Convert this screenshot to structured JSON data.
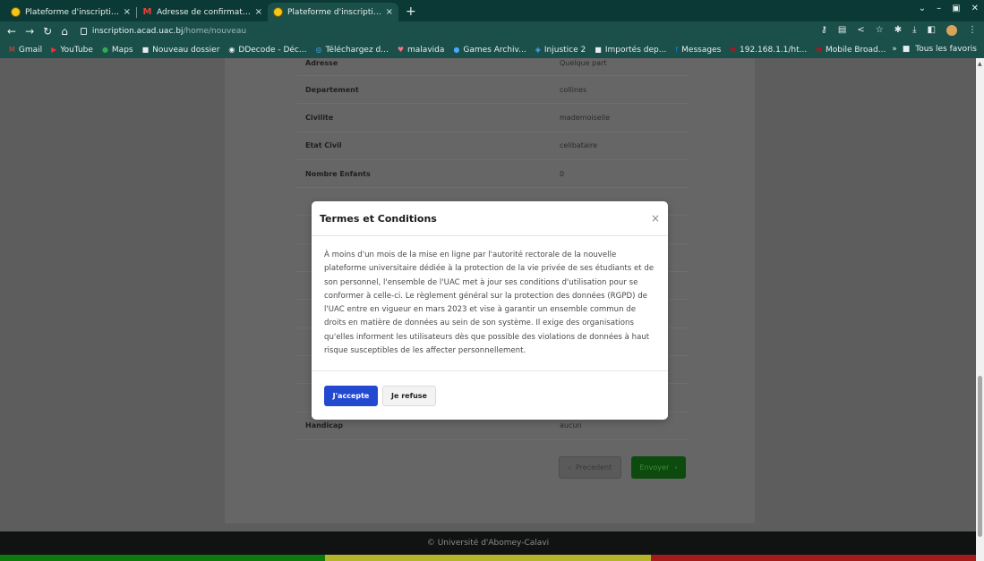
{
  "browser": {
    "tabs": [
      {
        "label": "Plateforme d'inscription",
        "icon": "uac-favicon-icon",
        "active": false
      },
      {
        "label": "Adresse de confirmation",
        "icon": "gmail-icon",
        "active": false
      },
      {
        "label": "Plateforme d'inscription",
        "icon": "uac-favicon-icon",
        "active": true
      }
    ],
    "url_host": "inscription.acad.uac.bj",
    "url_path": "/home/nouveau",
    "bookmarks": [
      {
        "label": "Gmail",
        "icon": "gmail-icon"
      },
      {
        "label": "YouTube",
        "icon": "youtube-icon"
      },
      {
        "label": "Maps",
        "icon": "maps-icon"
      },
      {
        "label": "Nouveau dossier",
        "icon": "folder-icon"
      },
      {
        "label": "DDecode - Déc...",
        "icon": "globe-icon"
      },
      {
        "label": "Téléchargez d...",
        "icon": "download-site-icon"
      },
      {
        "label": "malavida",
        "icon": "malavida-icon"
      },
      {
        "label": "Games Archiv...",
        "icon": "games-icon"
      },
      {
        "label": "Injustice 2",
        "icon": "injustice-icon"
      },
      {
        "label": "Importés dep...",
        "icon": "folder-icon"
      },
      {
        "label": "Messages",
        "icon": "facebook-icon"
      },
      {
        "label": "192.168.1.1/ht...",
        "icon": "huawei-icon"
      },
      {
        "label": "Mobile Broad...",
        "icon": "huawei-icon"
      }
    ],
    "all_bookmarks": "Tous les favoris"
  },
  "form": {
    "rows": [
      {
        "key": "Adresse",
        "value": "Quelque part"
      },
      {
        "key": "Departement",
        "value": "collines"
      },
      {
        "key": "Civilite",
        "value": "mademoiselle"
      },
      {
        "key": "Etat Civil",
        "value": "celibataire"
      },
      {
        "key": "Nombre Enfants",
        "value": "0"
      },
      {
        "key": "",
        "value": ""
      },
      {
        "key": "",
        "value": ""
      },
      {
        "key": "",
        "value": ""
      },
      {
        "key": "",
        "value": ""
      },
      {
        "key": "",
        "value": ""
      },
      {
        "key": "",
        "value": ""
      },
      {
        "key": "",
        "value": ""
      },
      {
        "key": "",
        "value": ""
      },
      {
        "key": "Handicap",
        "value": "aucun"
      }
    ],
    "prev_label": "Precedent",
    "send_label": "Envoyer"
  },
  "footer": {
    "text": "© Université d'Abomey-Calavi"
  },
  "flag_colors": [
    "#0e7a0e",
    "#b5b52a",
    "#a51b1b"
  ],
  "modal": {
    "title": "Termes et Conditions",
    "close_symbol": "×",
    "body": "À moins d'un mois de la mise en ligne par l'autorité rectorale de la nouvelle plateforme universitaire dédiée à la protection de la vie privée de ses étudiants et de son personnel, l'ensemble de l'UAC met à jour ses conditions d'utilisation pour se conformer à celle-ci. Le règlement général sur la protection des données (RGPD) de l'UAC entre en vigueur en mars 2023 et vise à garantir un ensemble commun de droits en matière de données au sein de son système. Il exige des organisations qu'elles informent les utilisateurs dès que possible des violations de données à haut risque susceptibles de les affecter personnellement.",
    "accept_label": "J'accepte",
    "refuse_label": "Je refuse"
  }
}
